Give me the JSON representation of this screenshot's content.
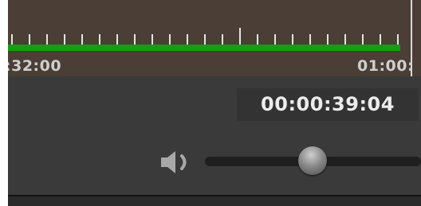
{
  "timeline": {
    "start_time": ":32:00",
    "end_time": "01:00:",
    "progress_color": "#139e13",
    "progress_fraction": 0.95
  },
  "player": {
    "current_time": "00:00:39:04"
  },
  "volume": {
    "icon": "speaker-volume-icon",
    "level": 0.53
  }
}
